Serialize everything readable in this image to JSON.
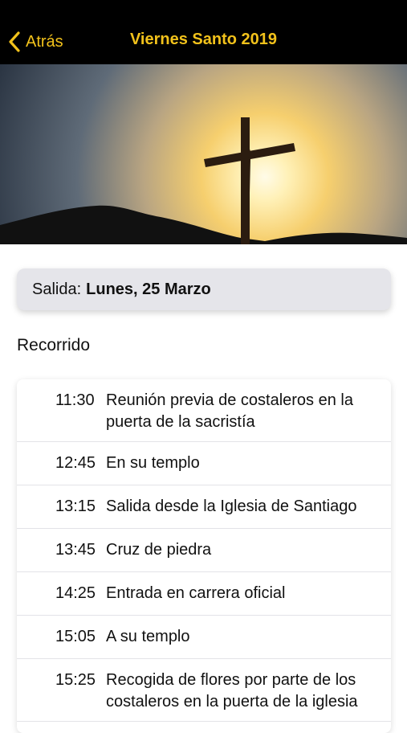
{
  "nav": {
    "back_label": "Atrás",
    "title": "Viernes Santo 2019",
    "accent_color": "#f2c21b",
    "back_icon": "chevron-left-icon"
  },
  "hero": {
    "image": "sunset-cross-image"
  },
  "salida": {
    "label": "Salida:",
    "value": "Lunes, 25 Marzo"
  },
  "recorrido": {
    "title": "Recorrido",
    "items": [
      {
        "time": "11:30",
        "desc": "Reunión previa de costaleros en la puerta de la sacristía"
      },
      {
        "time": "12:45",
        "desc": "En su templo"
      },
      {
        "time": "13:15",
        "desc": "Salida desde la Iglesia de Santiago"
      },
      {
        "time": "13:45",
        "desc": "Cruz de piedra"
      },
      {
        "time": "14:25",
        "desc": "Entrada en carrera oficial"
      },
      {
        "time": "15:05",
        "desc": "A su templo"
      },
      {
        "time": "15:25",
        "desc": "Recogida de flores por parte de los costaleros en la puerta de la iglesia"
      }
    ]
  }
}
